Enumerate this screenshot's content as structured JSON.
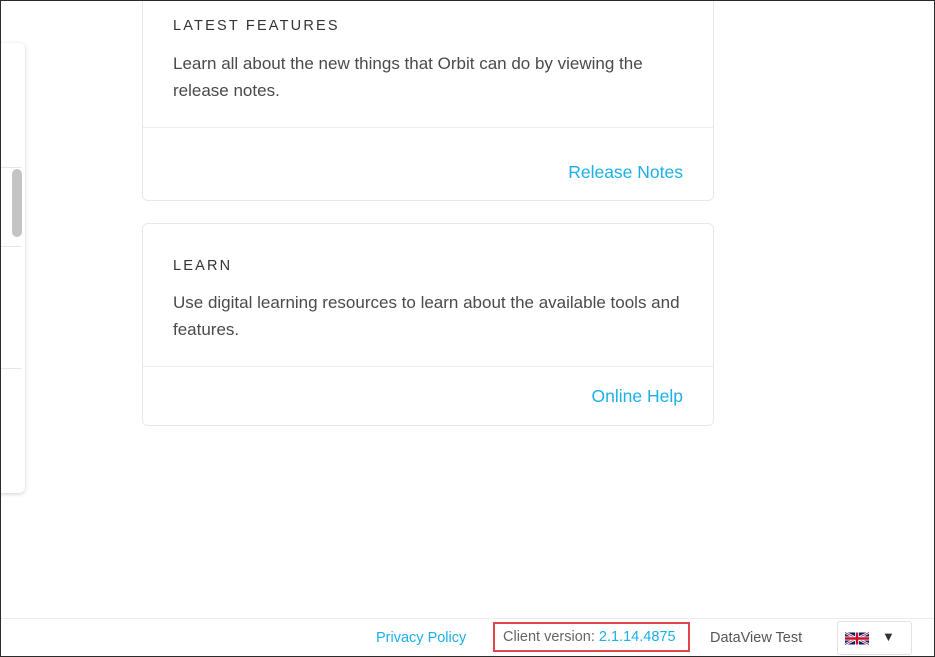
{
  "cards": {
    "features": {
      "title": "LATEST FEATURES",
      "description": "Learn all about the new things that Orbit can do by viewing the release notes.",
      "link_label": "Release Notes"
    },
    "learn": {
      "title": "LEARN",
      "description": "Use digital learning resources to learn about the available tools and features.",
      "link_label": "Online Help"
    }
  },
  "footer": {
    "privacy_label": "Privacy Policy",
    "version_label": "Client version:",
    "version_value": "2.1.14.4875",
    "site_name": "DataView Test",
    "language_icon": "uk-flag-icon",
    "caret_icon": "caret-down-icon"
  },
  "colors": {
    "link": "#1ab0e8",
    "highlight_border": "#e0474c"
  }
}
